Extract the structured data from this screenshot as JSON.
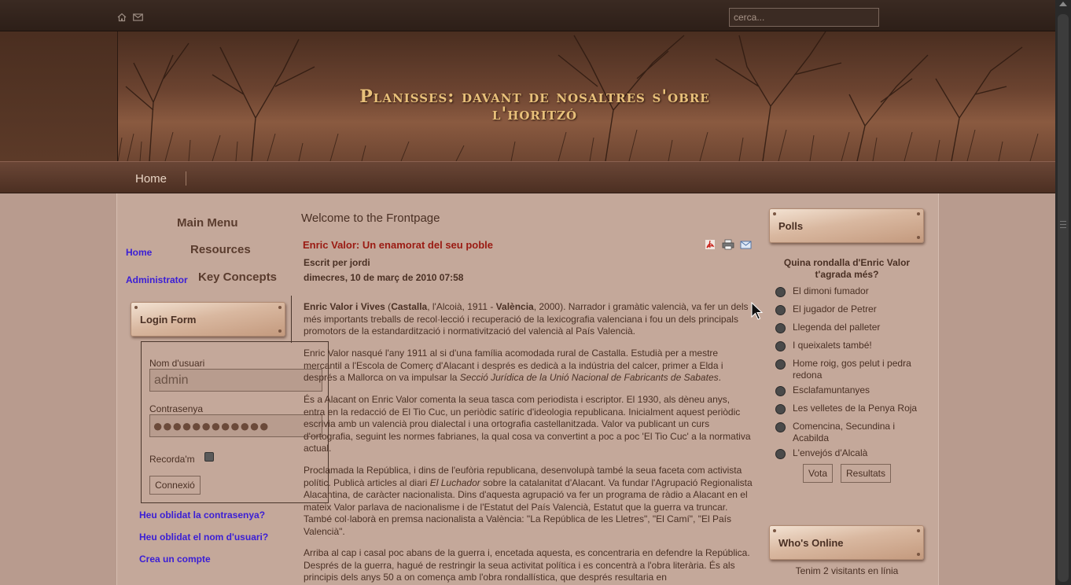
{
  "top_bar": {
    "search_placeholder": "cerca..."
  },
  "header": {
    "site_title_line1": "Planisses: davant de nosaltres s'obre",
    "site_title_line2": "l'horitzó"
  },
  "nav": {
    "home_label": "Home"
  },
  "left_column": {
    "main_menu_title": "Main Menu",
    "resources_title": "Resources",
    "key_concepts_title": "Key Concepts",
    "links": {
      "home": "Home",
      "administrator": "Administrator"
    },
    "login": {
      "module_title": "Login Form",
      "username_label": "Nom d'usuari",
      "username_value": "admin",
      "password_label": "Contrasenya",
      "password_dots": "●●●●●●●●●●●●",
      "remember_label": "Recorda'm",
      "submit_label": "Connexió",
      "forgot_password": "Heu oblidat la contrasenya?",
      "forgot_username": "Heu oblidat el nom d'usuari?",
      "create_account": "Crea un compte"
    }
  },
  "main": {
    "page_heading": "Welcome to the Frontpage",
    "article": {
      "title": "Enric Valor: Un enamorat del seu poble",
      "author": "Escrit per jordi",
      "date": "dimecres, 10 de març de 2010 07:58",
      "p1": {
        "name": "Enric Valor i Vives",
        "t1": " (",
        "place1": "Castalla",
        "t2": ", l'Alcoià, 1911 - ",
        "place2": "València",
        "t3": ", 2000). Narrador i gramàtic valencià, va fer un dels més importants treballs de recol·lecció i recuperació de la lexicografia valenciana i fou un dels principals promotors de la estandardització i normativització del valencià al País Valencià."
      },
      "p2": {
        "t1": "Enric Valor nasqué l'any 1911 al si d'una família acomodada rural de Castalla. Estudià per a mestre mercantil a l'Escola de Comerç d'Alacant i després es dedicà a la indústria del calcer, primer a Elda i després a Mallorca on va impulsar la ",
        "em": "Secció Jurídica de la Unió Nacional de Fabricants de Sabates",
        "t2": "."
      },
      "p3": "És a Alacant on Enric Valor comenta la seua tasca com periodista i escriptor. El 1930, als dèneu anys, entra en la redacció de El Tio Cuc, un periòdic satíric d'ideologia republicana. Inicialment aquest periòdic escrivia amb un valencià prou dialectal i una ortografia castellanitzada. Valor va publicant un curs d'ortografia, seguint les normes fabrianes, la qual cosa va convertint a poc a poc 'El Tio Cuc' a la normativa actual.",
      "p4": {
        "t1": "Proclamada la República, i dins de l'eufòria republicana, desenvolupà també la seua faceta com activista polític. Publicà articles al diari ",
        "em": "El Luchador",
        "t2": " sobre la catalanitat d'Alacant. Va fundar l'Agrupació Regionalista Alacantina, de caràcter nacionalista. Dins d'aquesta agrupació va fer un programa de ràdio a Alacant en el mateix Valor parlava de nacionalisme i de l'Estatut del País Valencià, Estatut que la guerra va truncar. També col·laborà en premsa nacionalista a València: \"La República de les Lletres\", \"El Camí\", \"El País Valencià\"."
      },
      "p5": "Arriba al cap i casal poc abans de la guerra i, encetada aquesta, es concentraria en defendre la República. Després de la guerra, hagué de restringir la seua activitat política i es concentrà a l'obra literària. És als principis dels anys 50 a on comença amb l'obra rondallística, que després resultaria en"
    }
  },
  "right_column": {
    "polls_title": "Polls",
    "poll_question": "Quina rondalla d'Enric Valor t'agrada més?",
    "options": [
      "El dimoni fumador",
      "El jugador de Petrer",
      "Llegenda del palleter",
      "I queixalets també!",
      "Home roig, gos pelut i pedra redona",
      "Esclafamuntanyes",
      "Les velletes de la Penya Roja",
      "Comencina, Secundina i Acabilda",
      "L'envejós d'Alcalà"
    ],
    "vote_label": "Vota",
    "results_label": "Resultats",
    "online_title": "Who's Online",
    "online_text": "Tenim 2 visitants en línia"
  },
  "colors": {
    "link": "#3a1ed6",
    "article_title": "#9a1a12",
    "site_title": "#e8c07a",
    "text": "#4a3024"
  }
}
